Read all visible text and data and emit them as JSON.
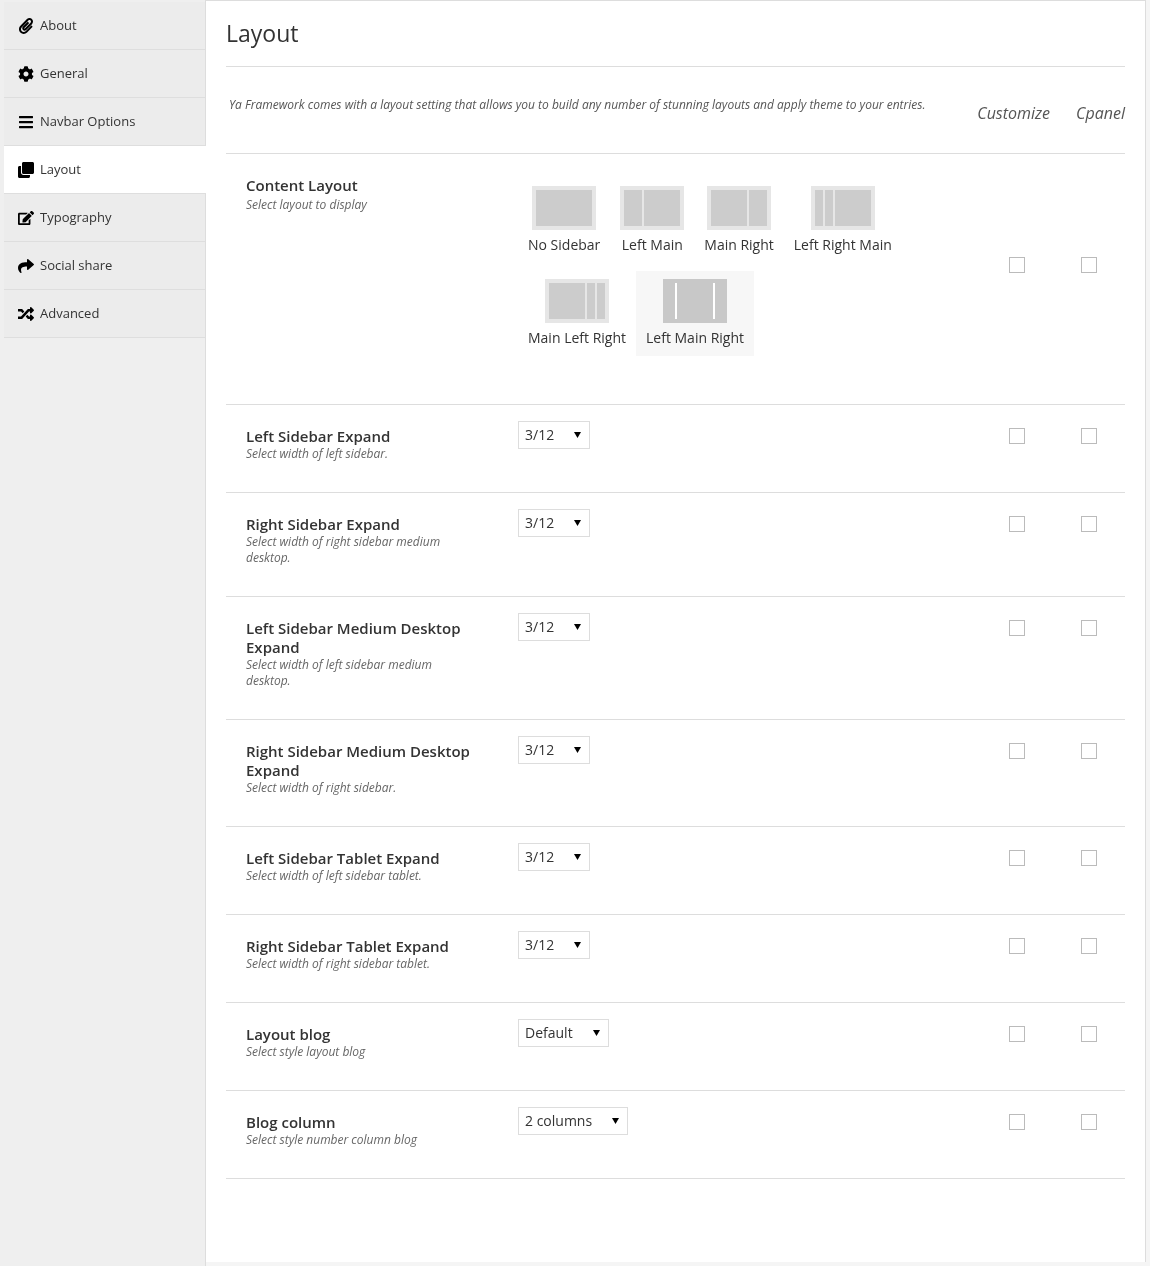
{
  "sidebar": {
    "items": [
      {
        "label": "About",
        "selected": false
      },
      {
        "label": "General",
        "selected": false
      },
      {
        "label": "Navbar Options",
        "selected": false
      },
      {
        "label": "Layout",
        "selected": true
      },
      {
        "label": "Typography",
        "selected": false
      },
      {
        "label": "Social share",
        "selected": false
      },
      {
        "label": "Advanced",
        "selected": false
      }
    ]
  },
  "page": {
    "title": "Layout",
    "description": "Ya Framework comes with a layout setting that allows you to build any number of stunning layouts and apply theme to your entries.",
    "columns": [
      "Customize",
      "Cpanel"
    ]
  },
  "content_layout": {
    "title": "Content Layout",
    "description": "Select layout to display",
    "customize": false,
    "cpanel": false,
    "options": [
      {
        "label": "No Sidebar",
        "kind": "none",
        "selected": false
      },
      {
        "label": "Left Main",
        "kind": "left-main",
        "selected": false
      },
      {
        "label": "Main Right",
        "kind": "main-right",
        "selected": false
      },
      {
        "label": "Left Right Main",
        "kind": "left-right-main",
        "selected": false
      },
      {
        "label": "Main Left Right",
        "kind": "main-left-right",
        "selected": false
      },
      {
        "label": "Left Main Right",
        "kind": "left-main-right",
        "selected": true
      }
    ]
  },
  "settings": [
    {
      "title": "Left Sidebar Expand",
      "description": "Select width of left sidebar.",
      "value": "3/12",
      "customize": false,
      "cpanel": false
    },
    {
      "title": "Right Sidebar Expand",
      "description": "Select width of right sidebar medium desktop.",
      "value": "3/12",
      "customize": false,
      "cpanel": false
    },
    {
      "title": "Left Sidebar Medium Desktop Expand",
      "description": "Select width of left sidebar medium desktop.",
      "value": "3/12",
      "customize": false,
      "cpanel": false
    },
    {
      "title": "Right Sidebar Medium Desktop Expand",
      "description": "Select width of right sidebar.",
      "value": "3/12",
      "customize": false,
      "cpanel": false
    },
    {
      "title": "Left Sidebar Tablet Expand",
      "description": "Select width of left sidebar tablet.",
      "value": "3/12",
      "customize": false,
      "cpanel": false
    },
    {
      "title": "Right Sidebar Tablet Expand",
      "description": "Select width of right sidebar tablet.",
      "value": "3/12",
      "customize": false,
      "cpanel": false
    },
    {
      "title": "Layout blog",
      "description": "Select style layout blog",
      "value": "Default",
      "customize": false,
      "cpanel": false
    },
    {
      "title": "Blog column",
      "description": "Select style number column blog",
      "value": "2 columns",
      "customize": false,
      "cpanel": false
    }
  ]
}
